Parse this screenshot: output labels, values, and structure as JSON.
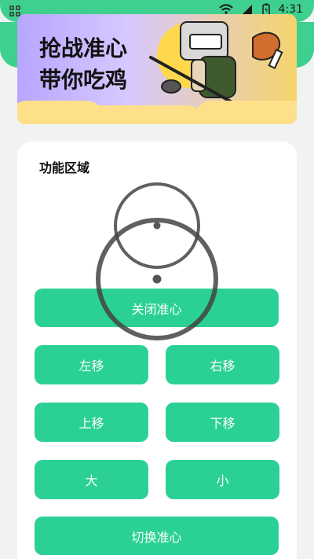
{
  "status_bar": {
    "time": "4:31",
    "icons": [
      "grid-icon",
      "wifi-icon",
      "signal-icon",
      "battery-icon"
    ]
  },
  "banner": {
    "line1": "抢战准心",
    "line2": "带你吃鸡"
  },
  "functions": {
    "title": "功能区域",
    "buttons": {
      "close_crosshair": "关闭准心",
      "move_left": "左移",
      "move_right": "右移",
      "move_up": "上移",
      "move_down": "下移",
      "bigger": "大",
      "smaller": "小",
      "switch_crosshair": "切换准心"
    }
  },
  "colors": {
    "accent": "#2bd194",
    "status_bar": "#3fcf8e"
  }
}
